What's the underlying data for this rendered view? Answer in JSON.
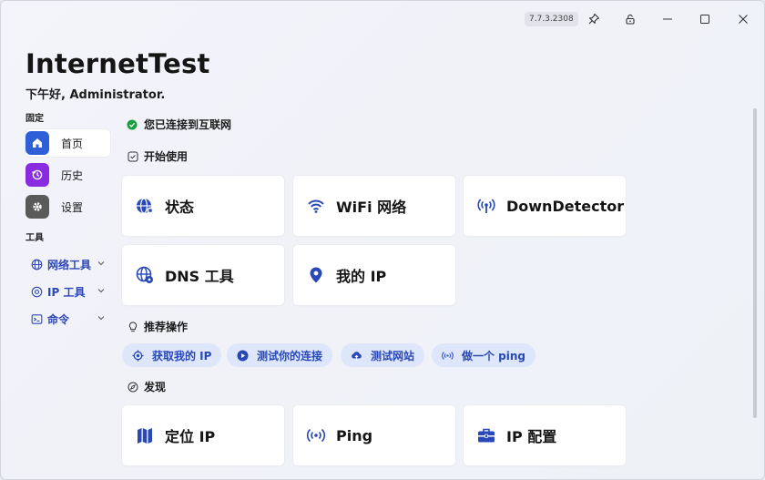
{
  "window": {
    "version": "7.7.3.2308",
    "buttons": {
      "pin": "pin-icon",
      "lock": "lock-icon",
      "minimize": "minimize-icon",
      "maximize": "maximize-icon",
      "close": "close-icon"
    }
  },
  "app": {
    "title": "InternetTest",
    "greeting": "下午好, Administrator."
  },
  "sidebar": {
    "pinned_label": "固定",
    "pinned": [
      {
        "label": "首页",
        "icon": "home-icon",
        "color": "#2f5fd8"
      },
      {
        "label": "历史",
        "icon": "history-icon",
        "color": "#8a2be2"
      },
      {
        "label": "设置",
        "icon": "gear-icon",
        "color": "#5a5a5a"
      }
    ],
    "tools_label": "工具",
    "tools": [
      {
        "label": "网络工具",
        "icon": "globe-icon"
      },
      {
        "label": "IP 工具",
        "icon": "location-icon"
      },
      {
        "label": "命令",
        "icon": "terminal-icon"
      }
    ]
  },
  "main": {
    "status": "您已连接到互联网",
    "start_heading": "开始使用",
    "start_cards": [
      {
        "label": "状态",
        "icon": "globe-status-icon"
      },
      {
        "label": "WiFi 网络",
        "icon": "wifi-icon"
      },
      {
        "label": "DownDetector",
        "icon": "broadcast-icon"
      },
      {
        "label": "DNS 工具",
        "icon": "dns-globe-icon"
      },
      {
        "label": "我的 IP",
        "icon": "map-pin-icon"
      }
    ],
    "recommend_heading": "推荐操作",
    "actions": [
      {
        "label": "获取我的 IP",
        "icon": "crosshair-icon"
      },
      {
        "label": "测试你的连接",
        "icon": "play-icon"
      },
      {
        "label": "测试网站",
        "icon": "cloud-upload-icon"
      },
      {
        "label": "做一个 ping",
        "icon": "ping-icon"
      }
    ],
    "discover_heading": "发现",
    "discover_cards": [
      {
        "label": "定位 IP",
        "icon": "map-icon"
      },
      {
        "label": "Ping",
        "icon": "ping-signal-icon"
      },
      {
        "label": "IP 配置",
        "icon": "toolbox-icon"
      }
    ]
  },
  "colors": {
    "accent": "#2d47b5",
    "status_ok": "#1a9e3f",
    "pill_bg": "#dde6fa"
  }
}
